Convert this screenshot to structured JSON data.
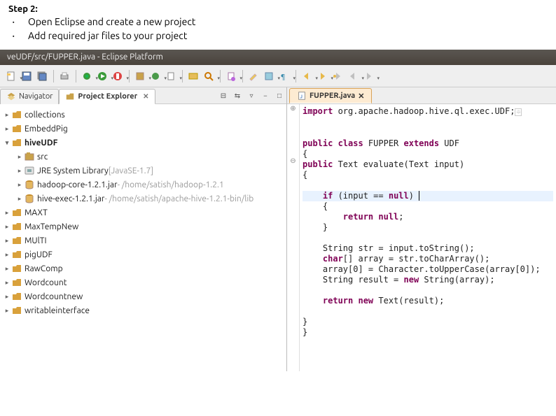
{
  "slide": {
    "heading": "Step 2:",
    "bullets": [
      "Open Eclipse and create a new project",
      "Add required jar files to your project"
    ]
  },
  "window": {
    "title": "veUDF/src/FUPPER.java - Eclipse Platform"
  },
  "views": {
    "navigator": "Navigator",
    "project_explorer": "Project Explorer",
    "view_icons": {
      "collapse": "⊟",
      "link": "⇆",
      "menu": "▿",
      "min": "−",
      "max": "□"
    },
    "collapse_all_title": "Collapse All"
  },
  "explorer": {
    "items": [
      {
        "kind": "project",
        "label": "collections"
      },
      {
        "kind": "project",
        "label": "EmbeddPig"
      },
      {
        "kind": "project-open",
        "label": "hiveUDF",
        "children": [
          {
            "kind": "src",
            "label": "src"
          },
          {
            "kind": "jre",
            "label": "JRE System Library",
            "suffix": " [JavaSE-1.7]"
          },
          {
            "kind": "jar",
            "label": "hadoop-core-1.2.1.jar",
            "suffix": " - /home/satish/hadoop-1.2.1"
          },
          {
            "kind": "jar",
            "label": "hive-exec-1.2.1.jar",
            "suffix": " - /home/satish/apache-hive-1.2.1-bin/lib"
          }
        ]
      },
      {
        "kind": "project",
        "label": "MAXT"
      },
      {
        "kind": "project",
        "label": "MaxTempNew"
      },
      {
        "kind": "project",
        "label": "MUlTI"
      },
      {
        "kind": "project",
        "label": "pigUDF"
      },
      {
        "kind": "project",
        "label": "RawComp"
      },
      {
        "kind": "project",
        "label": "Wordcount"
      },
      {
        "kind": "project",
        "label": "Wordcountnew"
      },
      {
        "kind": "project",
        "label": "writableinterface"
      }
    ]
  },
  "editor": {
    "tab": "FUPPER.java",
    "code": {
      "l1": {
        "a": "import",
        "b": " org.apache.hadoop.hive.ql.exec.UDF;",
        "end": "⯐"
      },
      "l2": "",
      "l3": "",
      "l4a": "public class ",
      "l4b": "FUPPER ",
      "l4c": "extends",
      "l4d": " UDF",
      "l5": "{",
      "l6a": "public",
      "l6b": " Text evaluate(Text input)",
      "l7": "{",
      "l8": "",
      "l9a": "    if",
      "l9b": " (input == ",
      "l9c": "null",
      "l9d": ") ",
      "l10": "    {",
      "l11a": "        return null",
      "l11b": ";",
      "l12": "    }",
      "l13": "",
      "l14": "    String str = input.toString();",
      "l15a": "    char",
      "l15b": "[] array = str.toCharArray();",
      "l16": "    array[0] = Character.toUpperCase(array[0]);",
      "l17a": "    String result = ",
      "l17b": "new",
      "l17c": " String(array);",
      "l18": "",
      "l19a": "    return new",
      "l19b": " Text(result);",
      "l20": "",
      "l21": "}",
      "l22": "}"
    }
  }
}
